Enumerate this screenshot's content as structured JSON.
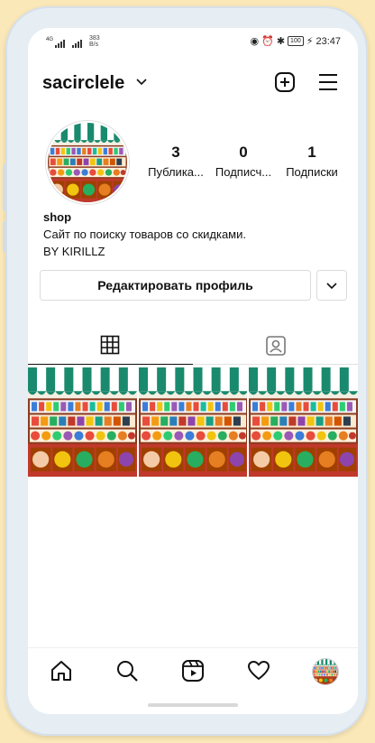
{
  "status_bar": {
    "signal_left": "4G",
    "speed_value": "383",
    "speed_unit": "B/s",
    "battery": "100",
    "time": "23:47"
  },
  "header": {
    "username": "sacirclele",
    "icons": [
      "chevron-down-icon",
      "add-post-icon",
      "menu-icon"
    ]
  },
  "profile": {
    "stats": [
      {
        "value": "3",
        "label": "Публика..."
      },
      {
        "value": "0",
        "label": "Подписч..."
      },
      {
        "value": "1",
        "label": "Подписки"
      }
    ],
    "name": "shop",
    "bio_lines": [
      "Сайт по поиску товаров со скидками.",
      "BY KIRILLZ"
    ],
    "edit_button": "Редактировать профиль"
  },
  "tabs": [
    "grid-icon",
    "tagged-icon"
  ],
  "posts": [
    "market-stall-image",
    "market-stall-image",
    "market-stall-image"
  ],
  "bottom_nav": [
    "home-icon",
    "search-icon",
    "reels-icon",
    "heart-icon",
    "profile-avatar"
  ],
  "colors": {
    "page_bg": "#fbe8b8",
    "awning_green": "#1a8a6e",
    "awning_white": "#ffffff",
    "shelf_red": "#c0392b"
  }
}
